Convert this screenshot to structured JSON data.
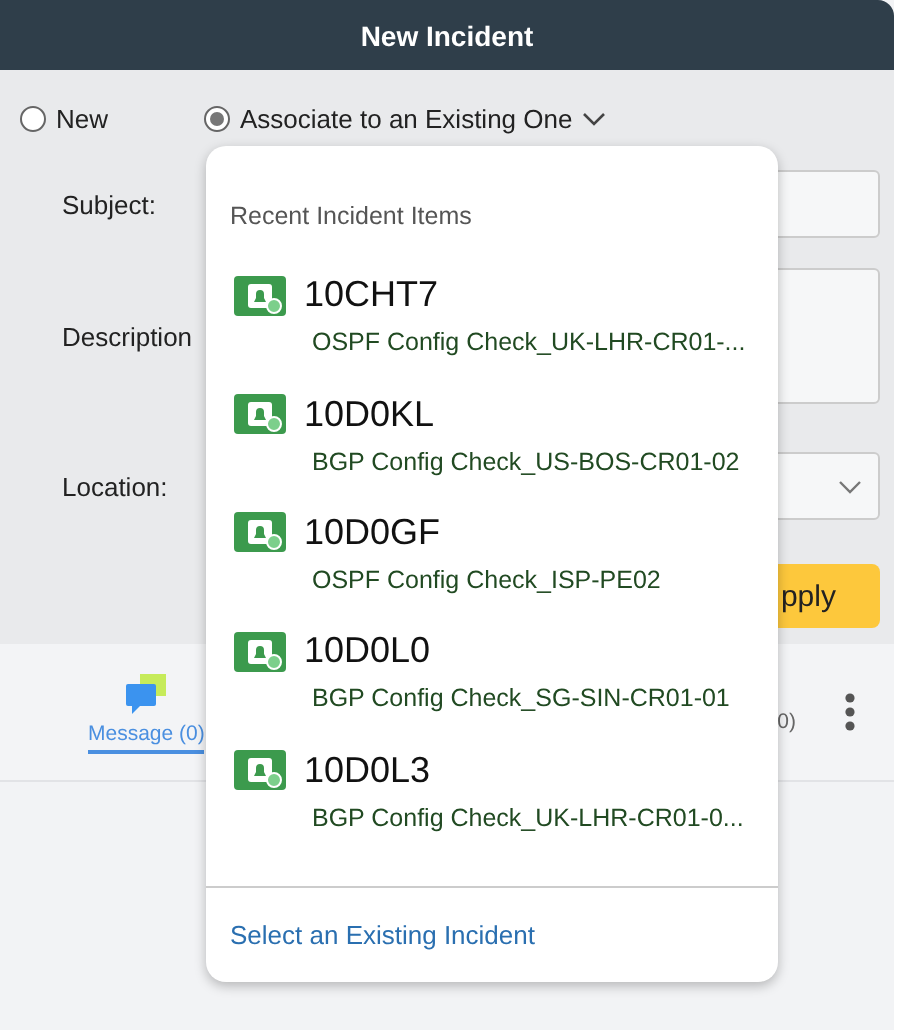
{
  "window": {
    "title": "New Incident"
  },
  "mode_options": [
    {
      "label": "New",
      "selected": false,
      "has_menu": false
    },
    {
      "label": "Associate to an Existing One",
      "selected": true,
      "has_menu": true
    }
  ],
  "form": {
    "fields": [
      {
        "label": "Subject:",
        "kind": "text"
      },
      {
        "label": "Description",
        "kind": "textarea"
      },
      {
        "label": "Location:",
        "kind": "select"
      }
    ],
    "apply_button": "pply"
  },
  "tabs": [
    {
      "label": "Message (0)",
      "selected": true
    },
    {
      "label": "0)",
      "selected": false
    }
  ],
  "dropdown": {
    "heading": "Recent Incident Items",
    "items": [
      {
        "id": "10CHT7",
        "subtitle": "OSPF Config Check_UK-LHR-CR01-..."
      },
      {
        "id": "10D0KL",
        "subtitle": "BGP Config Check_US-BOS-CR01-02"
      },
      {
        "id": "10D0GF",
        "subtitle": "OSPF Config Check_ISP-PE02"
      },
      {
        "id": "10D0L0",
        "subtitle": "BGP Config Check_SG-SIN-CR01-01"
      },
      {
        "id": "10D0L3",
        "subtitle": "BGP Config Check_UK-LHR-CR01-0..."
      }
    ],
    "footer_link": "Select an Existing Incident"
  }
}
